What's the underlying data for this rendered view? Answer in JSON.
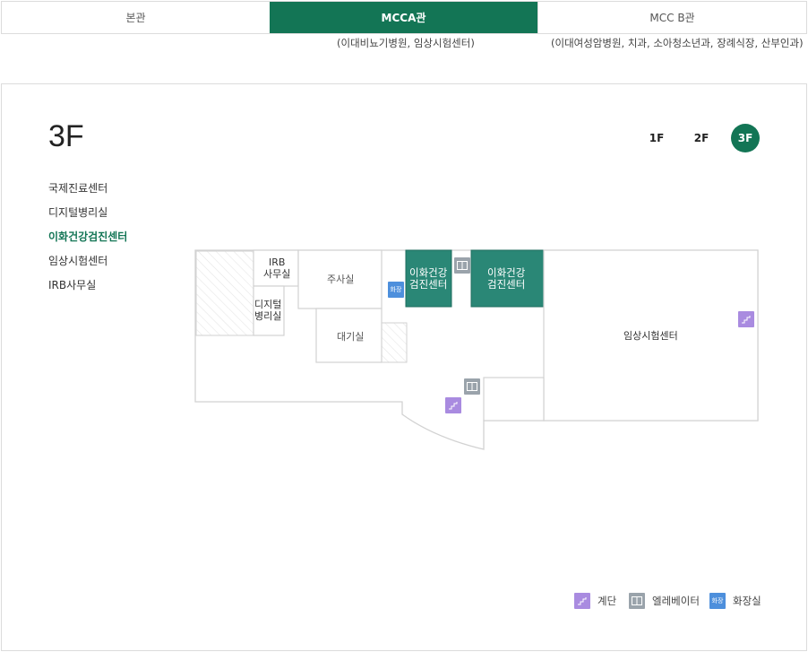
{
  "tabs": [
    {
      "label": "본관"
    },
    {
      "label": "MCCA관",
      "sub": "(이대비뇨기병원, 임상시험센터)"
    },
    {
      "label": "MCC B관",
      "sub": "(이대여성암병원, 치과, 소아청소년과, 장례식장, 산부인과)"
    }
  ],
  "floor": {
    "title": "3F",
    "buttons": [
      "1F",
      "2F",
      "3F"
    ],
    "active": "3F"
  },
  "departments": [
    "국제진료센터",
    "디지털병리실",
    "이화건강검진센터",
    "임상시험센터",
    "IRB사무실"
  ],
  "active_department": "이화건강검진센터",
  "rooms": {
    "irb": [
      "IRB",
      "사무실"
    ],
    "digital": [
      "디지털",
      "병리실"
    ],
    "injection": "주사실",
    "waiting": "대기실",
    "health1": [
      "이화건강",
      "검진센터"
    ],
    "health2": [
      "이화건강",
      "검진센터"
    ],
    "clinical": "임상시험센터",
    "intl": "국제진료센터"
  },
  "icons": {
    "stairs": "stairs-icon",
    "elevator": "elevator-icon",
    "restroom": "restroom-icon",
    "restroom_glyph": "화장"
  },
  "legend": [
    "계단",
    "엘레베이터",
    "화장실"
  ],
  "colors": {
    "accent": "#137555",
    "highlight_room": "#2a8776",
    "stairs": "#a98be0",
    "elevator": "#9aa3ab",
    "restroom": "#4d8fdc"
  }
}
